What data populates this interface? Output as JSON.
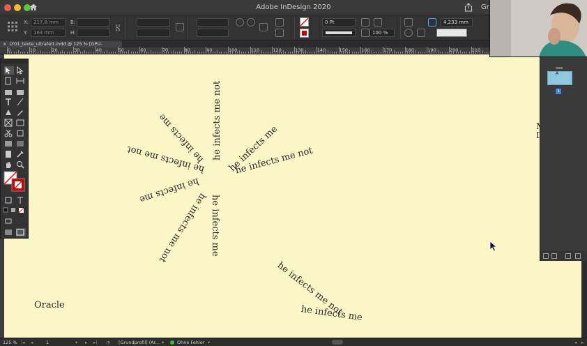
{
  "window": {
    "title": "Adobe InDesign 2020",
    "title_right": "Gr"
  },
  "control_bar": {
    "x_label": "X:",
    "x_value": "217,8 mm",
    "y_label": "Y:",
    "y_value": "164 mm",
    "w_label": "B:",
    "h_label": "H:",
    "stroke_weight": "0 Pt",
    "opacity": "100 %",
    "size_value": "4,233 mm"
  },
  "document": {
    "tab_label": "LY01_texte_ultrafett.indd @ 125 % [GPU-Vorschau]",
    "tab_close": "×"
  },
  "ruler": {
    "ticks": [
      "0",
      "10",
      "20",
      "30",
      "40",
      "50",
      "60",
      "70",
      "80",
      "90",
      "100",
      "110",
      "120",
      "130",
      "140",
      "150",
      "160",
      "170",
      "180",
      "190",
      "200",
      "210"
    ]
  },
  "canvas": {
    "phrases": [
      {
        "id": "p1",
        "text": "he infects me not"
      },
      {
        "id": "p2",
        "text": "he infects me"
      },
      {
        "id": "p3",
        "text": "he infects me not"
      },
      {
        "id": "p4",
        "text": "he infects me"
      },
      {
        "id": "p5",
        "text": "he infects me not"
      },
      {
        "id": "p6",
        "text": "he infects me"
      },
      {
        "id": "p7",
        "text": "he infects me not"
      },
      {
        "id": "p8",
        "text": "he infects me"
      },
      {
        "id": "p9",
        "text": "he infects me not"
      },
      {
        "id": "p10",
        "text": "he infects me"
      },
      {
        "id": "p11",
        "text": "he infects me not"
      }
    ],
    "oracle": "Oracle",
    "edge_text_1": "M",
    "edge_text_2": "D"
  },
  "pages_panel": {
    "master_label": "A",
    "page_number": "1"
  },
  "status_bar": {
    "zoom": "125 %",
    "page": "1",
    "profile": "[Grundprofil] (Ar...",
    "preflight": "Ohne Fehler"
  },
  "colors": {
    "page_background": "#fbf6c6",
    "ui_dark": "#323232",
    "accent_blue": "#3d86d8"
  }
}
